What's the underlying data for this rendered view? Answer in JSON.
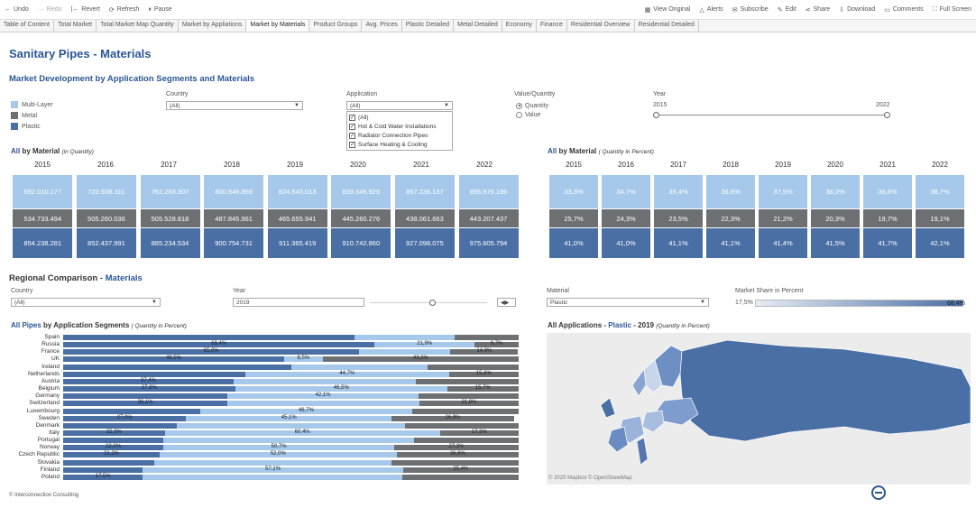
{
  "toolbar": {
    "undo": "Undo",
    "redo": "Redo",
    "revert": "Revert",
    "refresh": "Refresh",
    "pause": "Pause",
    "view_original": "View Original",
    "alerts": "Alerts",
    "subscribe": "Subscribe",
    "edit": "Edit",
    "share": "Share",
    "download": "Download",
    "comments": "Comments",
    "full_screen": "Full Screen"
  },
  "tabs": [
    "Table of Content",
    "Total Market",
    "Total Market Map Quantity",
    "Market by Appliations",
    "Market by Materials",
    "Product Groups",
    "Avg. Prices",
    "Plastic Detailed",
    "Metal Detailed",
    "Economy",
    "Finance",
    "Residential Overview",
    "Residential Detailed"
  ],
  "active_tab": "Market by Materials",
  "page_title": "Sanitary Pipes - Materials",
  "section1_title": "Market Development by Application Segments and Materials",
  "legend": [
    {
      "label": "Multi-Layer",
      "color": "#a6c8ea"
    },
    {
      "label": "Metal",
      "color": "#6d7073"
    },
    {
      "label": "Plastic",
      "color": "#4a6fa5"
    }
  ],
  "filters": {
    "country_label": "Country",
    "country_value": "(All)",
    "application_label": "Application",
    "application_value": "(All)",
    "application_options": [
      "(All)",
      "Hot & Cold Water Installations",
      "Radiator Connection Pipes",
      "Surface Heating & Cooling"
    ],
    "vq_label": "Value/Quantity",
    "vq_options": [
      "Quantity",
      "Value"
    ],
    "vq_selected": "Quantity",
    "year_label": "Year",
    "year_from": "2015",
    "year_to": "2022"
  },
  "abs_chart": {
    "title_prefix": "All",
    "title_main": " by Material",
    "title_note": "(in Quantity)",
    "years": [
      "2015",
      "2016",
      "2017",
      "2018",
      "2019",
      "2020",
      "2021",
      "2022"
    ],
    "multilayer": [
      "692.010.177",
      "720.938.311",
      "762.268.307",
      "800.948.869",
      "824.543.013",
      "839.349.925",
      "857.236.137",
      "896.979.196"
    ],
    "metal": [
      "534.733.494",
      "505.260.036",
      "505.528.818",
      "487.845.961",
      "465.655.941",
      "445.260.276",
      "438.061.663",
      "443.207.437"
    ],
    "plastic": [
      "854.238.281",
      "852.437.991",
      "885.234.534",
      "900.754.731",
      "911.365.419",
      "910.742.860",
      "927.098.075",
      "975.605.794"
    ]
  },
  "pct_chart": {
    "title_prefix": "All",
    "title_main": " by Material",
    "title_note": "( Quantity in Percent)",
    "years": [
      "2015",
      "2016",
      "2017",
      "2018",
      "2019",
      "2020",
      "2021",
      "2022"
    ],
    "multilayer": [
      "33,3%",
      "34,7%",
      "35,4%",
      "36,6%",
      "37,5%",
      "38,2%",
      "38,6%",
      "38,7%"
    ],
    "metal": [
      "25,7%",
      "24,3%",
      "23,5%",
      "22,3%",
      "21,2%",
      "20,3%",
      "19,7%",
      "19,1%"
    ],
    "plastic": [
      "41,0%",
      "41,0%",
      "41,1%",
      "41,1%",
      "41,4%",
      "41,5%",
      "41,7%",
      "42,1%"
    ]
  },
  "regional": {
    "title": "Regional Comparison - ",
    "title_b": "Materials",
    "country_label": "Country",
    "country_value": "(All)",
    "year_label": "Year",
    "year_value": "2019",
    "material_label": "Material",
    "material_value": "Plastic",
    "share_label": "Market Share in Percent",
    "share_min": "17,5%",
    "share_max": "68,4%"
  },
  "hbar": {
    "title_prefix": "All Pipes",
    "title_main": " by Application Segments",
    "title_note": "( Quantity in Percent)",
    "rows": [
      {
        "country": "Spain",
        "a": 64.0,
        "b": 22.0,
        "c": 14.0,
        "la": "",
        "lb": "",
        "lc": ""
      },
      {
        "country": "Russia",
        "a": 68.4,
        "b": 21.9,
        "c": 9.7,
        "la": "68,4%",
        "lb": "21,9%",
        "lc": "9,7%"
      },
      {
        "country": "France",
        "a": 65.0,
        "b": 20.0,
        "c": 14.9,
        "la": "65,0%",
        "lb": "",
        "lc": "14,9%"
      },
      {
        "country": "UK",
        "a": 48.5,
        "b": 8.5,
        "c": 43.0,
        "la": "48,5%",
        "lb": "8,5%",
        "lc": "43,0%"
      },
      {
        "country": "Ireland",
        "a": 50.0,
        "b": 30.0,
        "c": 20.0,
        "la": "",
        "lb": "",
        "lc": ""
      },
      {
        "country": "Netherlands",
        "a": 40.0,
        "b": 44.7,
        "c": 15.3,
        "la": "",
        "lb": "44,7%",
        "lc": "15,3%"
      },
      {
        "country": "Austria",
        "a": 37.4,
        "b": 40.0,
        "c": 22.6,
        "la": "37,4%",
        "lb": "",
        "lc": ""
      },
      {
        "country": "Belgium",
        "a": 37.8,
        "b": 46.5,
        "c": 15.7,
        "la": "37,8%",
        "lb": "46,5%",
        "lc": "15,7%"
      },
      {
        "country": "Germany",
        "a": 36.0,
        "b": 42.1,
        "c": 21.9,
        "la": "",
        "lb": "42,1%",
        "lc": ""
      },
      {
        "country": "Switzerland",
        "a": 36.1,
        "b": 42.1,
        "c": 21.8,
        "la": "36,1%",
        "lb": "",
        "lc": "21,8%"
      },
      {
        "country": "Luxembourg",
        "a": 30.0,
        "b": 46.7,
        "c": 23.3,
        "la": "",
        "lb": "46,7%",
        "lc": ""
      },
      {
        "country": "Sweden",
        "a": 27.0,
        "b": 45.1,
        "c": 26.9,
        "la": "27,0%",
        "lb": "45,1%",
        "lc": "26,9%"
      },
      {
        "country": "Denmark",
        "a": 25.0,
        "b": 50.0,
        "c": 25.0,
        "la": "",
        "lb": "",
        "lc": ""
      },
      {
        "country": "Italy",
        "a": 22.3,
        "b": 60.4,
        "c": 17.3,
        "la": "22,3%",
        "lb": "60,4%",
        "lc": "17,3%"
      },
      {
        "country": "Portugal",
        "a": 22.0,
        "b": 55.0,
        "c": 23.0,
        "la": "",
        "lb": "",
        "lc": ""
      },
      {
        "country": "Norway",
        "a": 22.0,
        "b": 50.7,
        "c": 27.3,
        "la": "22,0%",
        "lb": "50,7%",
        "lc": "27,3%"
      },
      {
        "country": "Czech Republic",
        "a": 21.2,
        "b": 52.0,
        "c": 26.8,
        "la": "21,2%",
        "lb": "52,0%",
        "lc": "26,8%"
      },
      {
        "country": "Slovakia",
        "a": 20.0,
        "b": 52.0,
        "c": 28.0,
        "la": "",
        "lb": "",
        "lc": ""
      },
      {
        "country": "Finland",
        "a": 17.5,
        "b": 57.1,
        "c": 25.4,
        "la": "",
        "lb": "57,1%",
        "lc": "25,4%"
      },
      {
        "country": "Poland",
        "a": 17.5,
        "b": 57.0,
        "c": 25.5,
        "la": "17,5%",
        "lb": "",
        "lc": ""
      }
    ]
  },
  "map": {
    "title_prefix": "All Applications - ",
    "title_material": "Plastic",
    "title_year": " - 2019",
    "title_note": "(Quantity in Percent)",
    "copyright": "© 2020 Mapbox © OpenStreetMap"
  },
  "footer": "© Interconnection Consulting"
}
